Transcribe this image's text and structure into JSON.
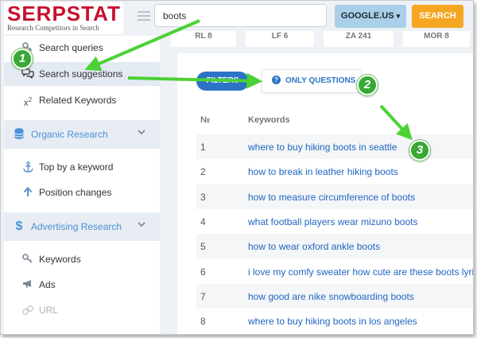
{
  "header": {
    "logo_text": "SERPSTAT",
    "logo_tagline": "Research Competitors in Search",
    "search_value": "boots",
    "database_label": "GOOGLE.US",
    "database_caret": "▾",
    "search_button": "SEARCH"
  },
  "sidebar": {
    "items": [
      {
        "label": "Search queries",
        "icon": "key-icon"
      },
      {
        "label": "Search suggestions",
        "icon": "speech-bubbles-icon"
      },
      {
        "label": "Related Keywords",
        "icon": "superscript-icon"
      }
    ],
    "organic_section": {
      "label": "Organic Research",
      "icon": "database-icon"
    },
    "organic_items": [
      {
        "label": "Top by a keyword",
        "icon": "anchor-icon"
      },
      {
        "label": "Position changes",
        "icon": "arrow-up-icon"
      }
    ],
    "advertising_section": {
      "label": "Advertising Research",
      "icon": "dollar-icon"
    },
    "advertising_items": [
      {
        "label": "Keywords",
        "icon": "key-icon"
      },
      {
        "label": "Ads",
        "icon": "megaphone-icon"
      },
      {
        "label": "URL",
        "icon": "link-icon"
      }
    ]
  },
  "stats": [
    "RL 8",
    "LF 6",
    "ZA 241",
    "MOR 8"
  ],
  "filters": {
    "filters_button": "FILTERS",
    "only_questions": "ONLY QUESTIONS"
  },
  "table": {
    "columns": [
      "№",
      "Keywords"
    ],
    "rows": [
      {
        "num": "1",
        "keyword": "where to buy hiking boots in seattle"
      },
      {
        "num": "2",
        "keyword": "how to break in leather hiking boots"
      },
      {
        "num": "3",
        "keyword": "how to measure circumference of boots"
      },
      {
        "num": "4",
        "keyword": "what football players wear mizuno boots"
      },
      {
        "num": "5",
        "keyword": "how to wear oxford ankle boots"
      },
      {
        "num": "6",
        "keyword": "i love my comfy sweater how cute are these boots lyrics"
      },
      {
        "num": "7",
        "keyword": "how good are nike snowboarding boots"
      },
      {
        "num": "8",
        "keyword": "where to buy hiking boots in los angeles"
      }
    ]
  },
  "annotations": {
    "steps": [
      "1",
      "2",
      "3"
    ],
    "arrow_color": "#4cd137"
  }
}
